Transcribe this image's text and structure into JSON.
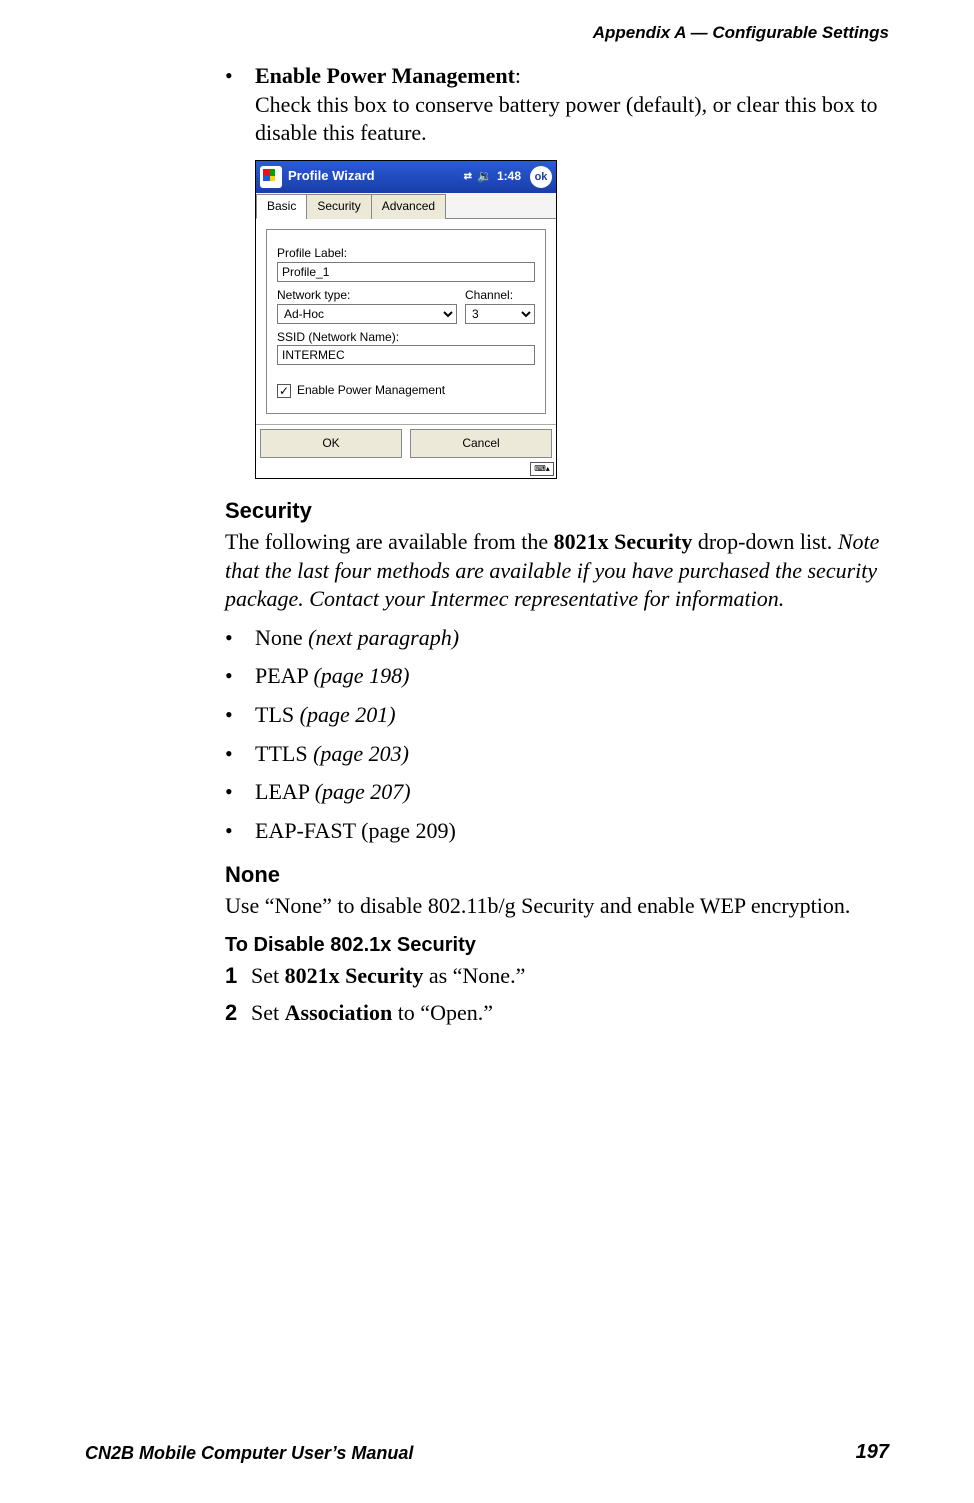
{
  "header": {
    "text": "Appendix A —  Configurable Settings"
  },
  "topBullet": {
    "title": "Enable Power Management",
    "colon": ":",
    "desc": "Check this box to conserve battery power (default), or clear this box to disable this feature."
  },
  "screenshot": {
    "title": "Profile Wizard",
    "time": "1:48",
    "ok": "ok",
    "tabs": {
      "basic": "Basic",
      "security": "Security",
      "advanced": "Advanced"
    },
    "profileLabel_lbl": "Profile Label:",
    "profileLabel_val": "Profile_1",
    "networkType_lbl": "Network type:",
    "networkType_val": "Ad-Hoc",
    "channel_lbl": "Channel:",
    "channel_val": "3",
    "ssid_lbl": "SSID (Network Name):",
    "ssid_val": "INTERMEC",
    "cb_checked": "✓",
    "cb_label": "Enable Power Management",
    "ok_btn": "OK",
    "cancel_btn": "Cancel"
  },
  "security": {
    "heading": "Security",
    "intro_a": "The following are available from the ",
    "intro_bold": "8021x Security",
    "intro_b": " drop-down list. ",
    "intro_italic": "Note that the last four methods are available if you have purchased the security package. Contact your Intermec representative for information.",
    "items": [
      {
        "label": "None ",
        "ref_italic": "(next paragraph)"
      },
      {
        "label": "PEAP ",
        "ref_italic": "(page 198)"
      },
      {
        "label": "TLS ",
        "ref_italic": "(page 201)"
      },
      {
        "label": "TTLS ",
        "ref_italic": "(page 203)"
      },
      {
        "label": "LEAP ",
        "ref_italic": "(page 207)"
      },
      {
        "label": "EAP-FAST (page 209)",
        "ref_italic": ""
      }
    ]
  },
  "none": {
    "heading": "None",
    "para": "Use “None” to disable 802.11b/g Security and enable WEP encryption.",
    "subheading": "To Disable 802.1x Security",
    "steps": [
      {
        "n": "1",
        "a": "Set ",
        "bold": "8021x Security",
        "b": " as “None.”"
      },
      {
        "n": "2",
        "a": "Set ",
        "bold": "Association",
        "b": " to “Open.”"
      }
    ]
  },
  "footer": {
    "left": "CN2B Mobile Computer User’s Manual",
    "right": "197"
  }
}
